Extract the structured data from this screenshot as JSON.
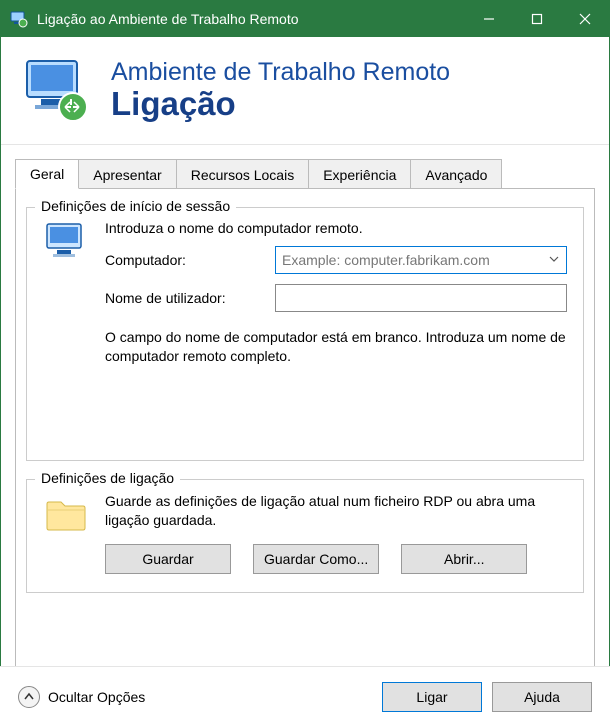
{
  "window": {
    "title": "Ligação ao Ambiente de Trabalho Remoto"
  },
  "header": {
    "line1": "Ambiente de Trabalho Remoto",
    "line2": "Ligação"
  },
  "tabs": {
    "general": "Geral",
    "display": "Apresentar",
    "localres": "Recursos Locais",
    "experience": "Experiência",
    "advanced": "Avançado"
  },
  "logon": {
    "legend": "Definições de início de sessão",
    "instruction": "Introduza o nome do computador remoto.",
    "computer_label": "Computador:",
    "computer_placeholder": "Example: computer.fabrikam.com",
    "computer_value": "",
    "username_label": "Nome de utilizador:",
    "username_value": "",
    "note": "O campo do nome de computador está em branco. Introduza um nome de computador remoto completo."
  },
  "connection": {
    "legend": "Definições de ligação",
    "text": "Guarde as definições de ligação atual num ficheiro RDP ou abra uma ligação guardada.",
    "save": "Guardar",
    "saveas": "Guardar Como...",
    "open": "Abrir..."
  },
  "footer": {
    "hide_options": "Ocultar Opções",
    "connect": "Ligar",
    "help": "Ajuda"
  }
}
